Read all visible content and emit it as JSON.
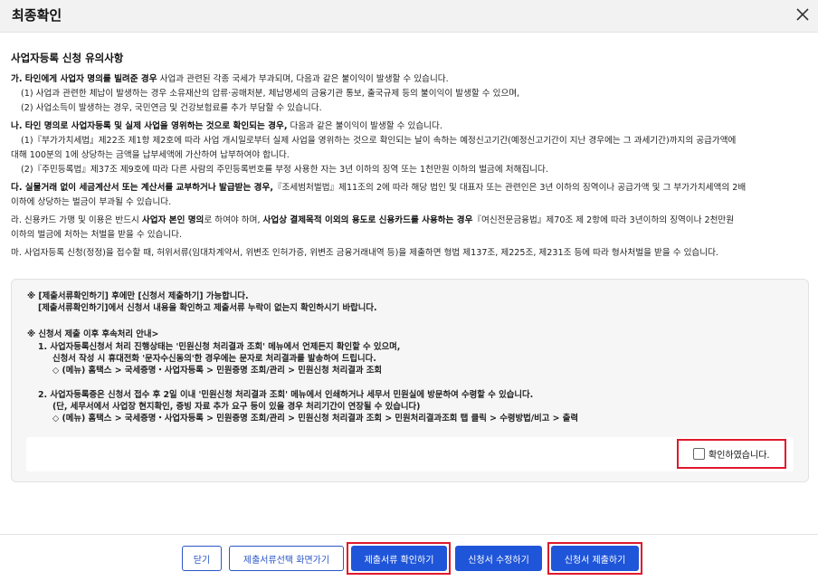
{
  "dialog": {
    "title": "최종확인"
  },
  "section": {
    "title": "사업자등록 신청 유의사항"
  },
  "items": {
    "ga_bold": "가. 타인에게 사업자 명의를 빌려준 경우",
    "ga_rest": " 사업과 관련된 각종 국세가 부과되며, 다음과 같은 불이익이 발생할 수 있습니다.",
    "ga_1": "(1) 사업과 관련한 체납이 발생하는 경우 소유재산의 압류·공매처분, 체납명세의 금융기관 통보, 출국규제 등의 불이익이 발생할 수 있으며,",
    "ga_2": "(2) 사업소득이 발생하는 경우, 국민연금 및 건강보험료를 추가 부담할 수 있습니다.",
    "na_bold": "나. 타인 명의로 사업자등록 및 실제 사업을 영위하는 것으로 확인되는 경우,",
    "na_rest": " 다음과 같은 불이익이 발생할 수 있습니다.",
    "na_1a": "(1)『부가가치세법』제22조 제1항 제2호에 따라 사업 개시일로부터 실제 사업을 영위하는 것으로 확인되는 날이 속하는 예정신고기간(예정신고기간이 지난 경우에는 그 과세기간)까지의 공급가액에",
    "na_1b": "대해 100분의 1에 상당하는 금액을 납부세액에 가산하여 납부하여야 합니다.",
    "na_2": "(2)『주민등록법』제37조 제9호에 따라 다른 사람의 주민등록번호를 부정 사용한 자는 3년 이하의 징역 또는 1천만원 이하의 벌금에 처해집니다.",
    "da_bold": "다. 실물거래 없이 세금계산서 또는 계산서를 교부하거나 발급받는 경우,",
    "da_rest": "『조세범처벌법』제11조의 2에 따라 해당 법인 및 대표자 또는 관련인은 3년 이하의 징역이나 공급가액 및 그 부가가치세액의 2배",
    "da_2": "이하에 상당하는 벌금이 부과될 수 있습니다.",
    "ra_a": "라. 신용카드 가맹 및 이용은 반드시 ",
    "ra_b": "사업자 본인 명의",
    "ra_c": "로 하여야 하며, ",
    "ra_d": "사업상 결제목적 이외의 용도로 신용카드를 사용하는 경우",
    "ra_e": "『여신전문금융법』제70조 제 2항에 따라 3년이하의 징역이나 2천만원",
    "ra_2": "이하의 벌금에 처하는 처벌을 받을 수 있습니다.",
    "ma": "마. 사업자등록 신청(정정)을 접수할 때, 허위서류(임대차계약서, 위변조 인허가증, 위변조 금융거래내역 등)을 제출하면 형법 제137조, 제225조, 제231조 등에 따라 형사처벌을 받을 수 있습니다."
  },
  "notice": {
    "l1": "※ [제출서류확인하기] 후에만 [신청서 제출하기] 가능합니다.",
    "l2": "[제출서류확인하기]에서 신청서 내용을 확인하고 제출서류 누락이 없는지 확인하시기 바랍니다.",
    "l3": "※ 신청서 제출 이후 후속처리 안내>",
    "l4": "1.  사업자등록신청서 처리 진행상태는 '민원신청 처리결과 조회' 메뉴에서 언제든지 확인할 수 있으며,",
    "l5": "신청서 작성 시 휴대전화 '문자수신동의'한 경우에는 문자로 처리결과를 발송하여 드립니다.",
    "l6": "◇ (메뉴) 홈택스 > 국세증명・사업자등록 > 민원증명 조회/관리 > 민원신청 처리결과 조회",
    "l7": "2.  사업자등록증은 신청서 접수 후 2일 이내 '민원신청 처리결과 조회' 메뉴에서 인쇄하거나 세무서 민원실에 방문하여 수령할 수 있습니다.",
    "l8": "(단, 세무서에서 사업장 현지확인, 증빙 자료 추가 요구 등이 있을 경우 처리기간이 연장될 수 있습니다)",
    "l9": "◇ (메뉴) 홈택스 > 국세증명・사업자등록 > 민원증명 조회/관리 > 민원신청 처리결과 조회 > 민원처리결과조회 탭 클릭 > 수령방법/비고 > 출력",
    "confirm_label": "확인하였습니다."
  },
  "buttons": {
    "close": "닫기",
    "doc_select": "제출서류선택 화면가기",
    "doc_check": "제출서류 확인하기",
    "edit": "신청서 수정하기",
    "submit": "신청서 제출하기"
  },
  "colors": {
    "primary": "#1f55d8",
    "highlight": "#e0192b"
  },
  "icons": {
    "close": "close-icon"
  }
}
